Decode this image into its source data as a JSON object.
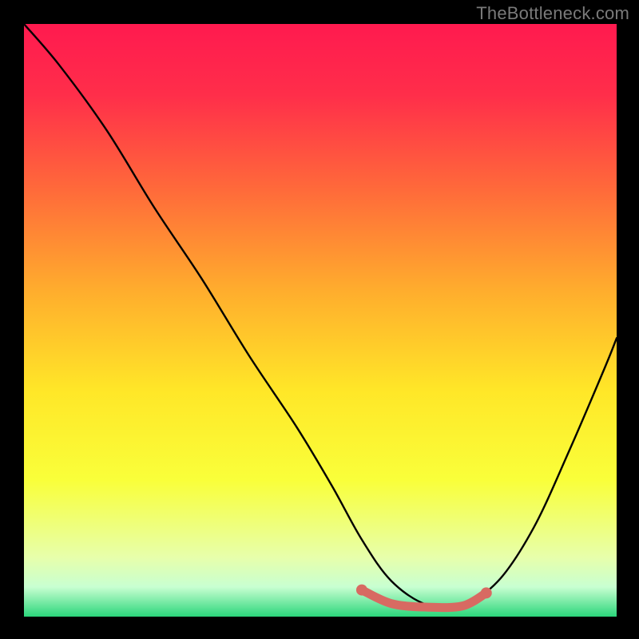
{
  "attribution": "TheBottleneck.com",
  "chart_data": {
    "type": "line",
    "title": "",
    "xlabel": "",
    "ylabel": "",
    "xlim": [
      0,
      100
    ],
    "ylim": [
      0,
      100
    ],
    "background_gradient_stops": [
      {
        "offset": 0,
        "color": "#ff1a4f"
      },
      {
        "offset": 12,
        "color": "#ff2e4a"
      },
      {
        "offset": 28,
        "color": "#ff6a3a"
      },
      {
        "offset": 45,
        "color": "#ffad2d"
      },
      {
        "offset": 62,
        "color": "#ffe728"
      },
      {
        "offset": 77,
        "color": "#f9ff3a"
      },
      {
        "offset": 90,
        "color": "#e7ffab"
      },
      {
        "offset": 95,
        "color": "#c8ffd1"
      },
      {
        "offset": 100,
        "color": "#2bd67b"
      }
    ],
    "series": [
      {
        "name": "bottleneck-curve",
        "color": "#000000",
        "x": [
          0,
          6,
          14,
          22,
          30,
          38,
          46,
          52,
          57,
          62,
          68,
          74,
          80,
          86,
          92,
          98,
          100
        ],
        "y": [
          100,
          93,
          82,
          69,
          57,
          44,
          32,
          22,
          13,
          6,
          2,
          2,
          6,
          15,
          28,
          42,
          47
        ]
      }
    ],
    "highlight_segment": {
      "name": "optimal-range",
      "color": "#d86a62",
      "x": [
        57,
        62,
        68,
        74,
        78
      ],
      "y": [
        4.5,
        2.2,
        1.6,
        1.8,
        4.0
      ],
      "endpoint_dots": true
    }
  }
}
